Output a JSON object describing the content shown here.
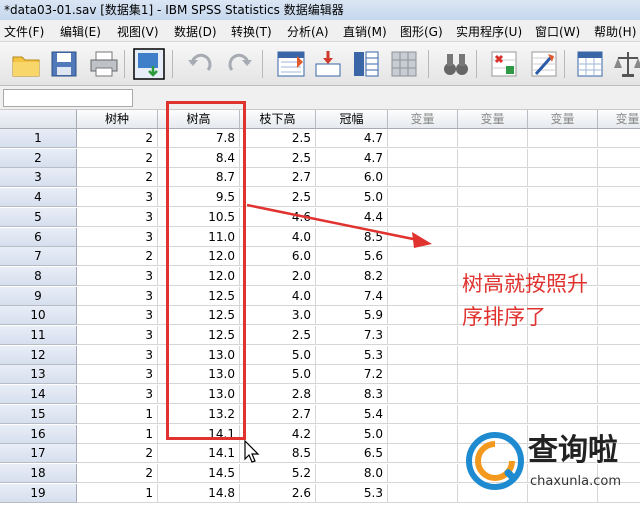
{
  "window": {
    "title": "*data03-01.sav [数据集1] - IBM SPSS Statistics 数据编辑器"
  },
  "menu": [
    "文件(F)",
    "编辑(E)",
    "视图(V)",
    "数据(D)",
    "转换(T)",
    "分析(A)",
    "直销(M)",
    "图形(G)",
    "实用程序(U)",
    "窗口(W)",
    "帮助(H)"
  ],
  "toolbar": {
    "icons": [
      "open-folder-icon",
      "save-icon",
      "print-icon",
      "dialog-recall-icon",
      "undo-icon",
      "redo-icon",
      "goto-case-icon",
      "goto-variable-icon",
      "variables-icon",
      "grid-icon",
      "binoculars-icon",
      "insert-cases-icon",
      "split-file-icon",
      "select-cases-icon",
      "weight-cases-icon"
    ]
  },
  "grid": {
    "columns": [
      "树种",
      "树高",
      "枝下高",
      "冠幅",
      "变量",
      "变量",
      "变量",
      "变量"
    ],
    "rows": [
      {
        "n": "1",
        "v": [
          "2",
          "7.8",
          "2.5",
          "4.7"
        ]
      },
      {
        "n": "2",
        "v": [
          "2",
          "8.4",
          "2.5",
          "4.7"
        ]
      },
      {
        "n": "3",
        "v": [
          "2",
          "8.7",
          "2.7",
          "6.0"
        ]
      },
      {
        "n": "4",
        "v": [
          "3",
          "9.5",
          "2.5",
          "5.0"
        ]
      },
      {
        "n": "5",
        "v": [
          "3",
          "10.5",
          "4.6",
          "4.4"
        ]
      },
      {
        "n": "6",
        "v": [
          "3",
          "11.0",
          "4.0",
          "8.5"
        ]
      },
      {
        "n": "7",
        "v": [
          "2",
          "12.0",
          "6.0",
          "5.6"
        ]
      },
      {
        "n": "8",
        "v": [
          "3",
          "12.0",
          "2.0",
          "8.2"
        ]
      },
      {
        "n": "9",
        "v": [
          "3",
          "12.5",
          "4.0",
          "7.4"
        ]
      },
      {
        "n": "10",
        "v": [
          "3",
          "12.5",
          "3.0",
          "5.9"
        ]
      },
      {
        "n": "11",
        "v": [
          "3",
          "12.5",
          "2.5",
          "7.3"
        ]
      },
      {
        "n": "12",
        "v": [
          "3",
          "13.0",
          "5.0",
          "5.3"
        ]
      },
      {
        "n": "13",
        "v": [
          "3",
          "13.0",
          "5.0",
          "7.2"
        ]
      },
      {
        "n": "14",
        "v": [
          "3",
          "13.0",
          "2.8",
          "8.3"
        ]
      },
      {
        "n": "15",
        "v": [
          "1",
          "13.2",
          "2.7",
          "5.4"
        ]
      },
      {
        "n": "16",
        "v": [
          "1",
          "14.1",
          "4.2",
          "5.0"
        ]
      },
      {
        "n": "17",
        "v": [
          "2",
          "14.1",
          "8.5",
          "6.5"
        ]
      },
      {
        "n": "18",
        "v": [
          "2",
          "14.5",
          "5.2",
          "8.0"
        ]
      },
      {
        "n": "19",
        "v": [
          "1",
          "14.8",
          "2.6",
          "5.3"
        ]
      }
    ]
  },
  "annotation": {
    "line1": "树高就按照升",
    "line2": "序排序了",
    "color": "#e0322e"
  },
  "watermark": {
    "title": "查询啦",
    "url": "chaxunla.com"
  }
}
